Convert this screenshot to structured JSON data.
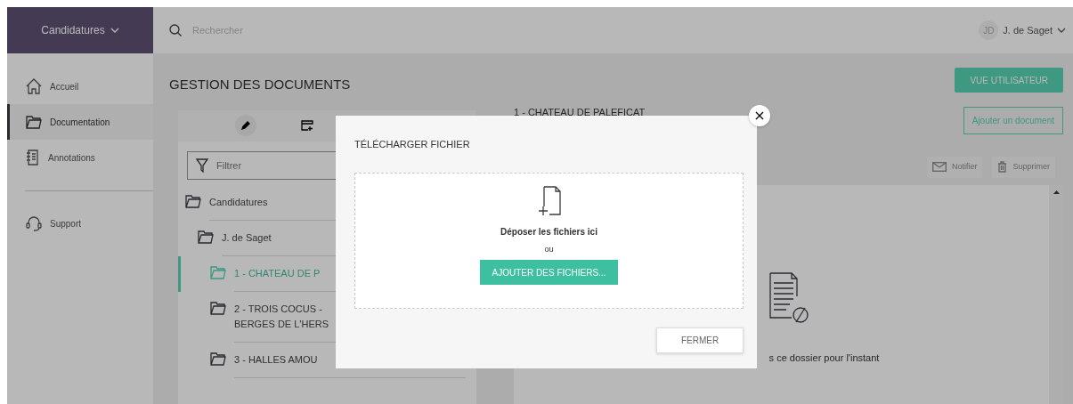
{
  "topbar": {
    "workspace": "Candidatures",
    "search": {
      "placeholder": "Rechercher"
    },
    "user": {
      "initials": "JD",
      "name": "J. de Saget"
    }
  },
  "sidebar": {
    "main_items": [
      {
        "label": "Accueil",
        "selected": false
      },
      {
        "label": "Documentation",
        "selected": true
      },
      {
        "label": "Annotations",
        "selected": false
      }
    ],
    "bottom_items": [
      {
        "label": "Support",
        "selected": false
      }
    ]
  },
  "page": {
    "title": "GESTION DES DOCUMENTS",
    "view_button": "VUE UTILISATEUR"
  },
  "tree_panel": {
    "filter": {
      "placeholder": "Filtrer"
    },
    "tree": [
      {
        "label": "Candidatures",
        "selected": false,
        "children": [
          {
            "label": "J. de Saget",
            "selected": false,
            "children": [
              {
                "label": "1 - CHATEAU DE P",
                "selected": true
              },
              {
                "label": "2 - TROIS COCUS - BERGES DE L'HERS",
                "selected": false
              },
              {
                "label": "3 - HALLES AMOU",
                "selected": false
              }
            ]
          }
        ]
      }
    ]
  },
  "document_panel": {
    "title": "1 - CHATEAU DE PALEFICAT",
    "add_button": "Ajouter un document",
    "actions": [
      {
        "label": "Notifier",
        "disabled": true
      },
      {
        "label": "Supprimer",
        "disabled": true
      }
    ],
    "empty_message": "s ce dossier pour l'instant"
  },
  "dialog": {
    "title": "TÉLÉCHARGER FICHIER",
    "drop_text": "Déposer les fichiers ici",
    "or_text": "ou",
    "add_button": "AJOUTER DES FICHIERS...",
    "close_button": "FERMER"
  }
}
